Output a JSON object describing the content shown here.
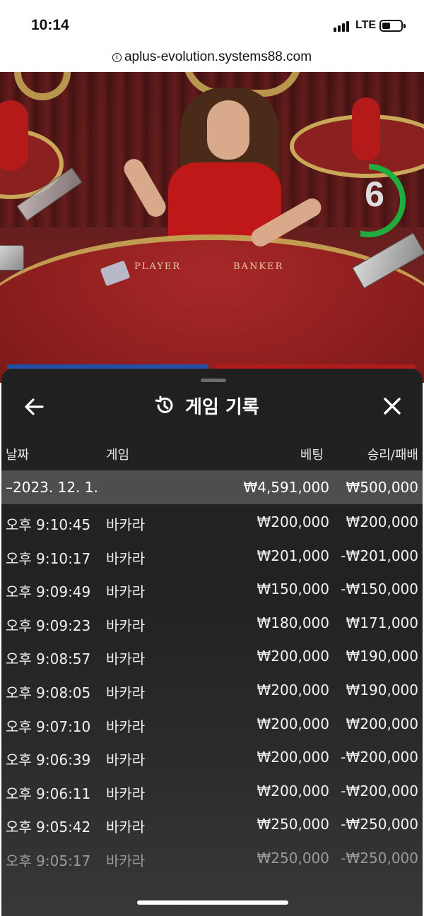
{
  "status_bar": {
    "time": "10:14",
    "network": "LTE"
  },
  "browser": {
    "url": "aplus-evolution.systems88.com"
  },
  "video": {
    "countdown": "6",
    "countdown_progress": 0.6,
    "table_labels": [
      "PLAYER",
      "BANKER"
    ]
  },
  "history": {
    "title": "게임 기록",
    "icons": {
      "back": "arrow-left-icon",
      "close": "close-x-icon",
      "title": "history-icon"
    },
    "columns": {
      "date": "날짜",
      "game": "게임",
      "bet": "베팅",
      "result": "승리/패배"
    },
    "group": {
      "date": "–2023. 12. 1.",
      "total_bet": "₩4,591,000",
      "total_result": "₩500,000"
    },
    "rows": [
      {
        "time": "오후 9:10:45",
        "game": "바카라",
        "bet": "₩200,000",
        "result": "₩200,000"
      },
      {
        "time": "오후 9:10:17",
        "game": "바카라",
        "bet": "₩201,000",
        "result": "-₩201,000"
      },
      {
        "time": "오후 9:09:49",
        "game": "바카라",
        "bet": "₩150,000",
        "result": "-₩150,000"
      },
      {
        "time": "오후 9:09:23",
        "game": "바카라",
        "bet": "₩180,000",
        "result": "₩171,000"
      },
      {
        "time": "오후 9:08:57",
        "game": "바카라",
        "bet": "₩200,000",
        "result": "₩190,000"
      },
      {
        "time": "오후 9:08:05",
        "game": "바카라",
        "bet": "₩200,000",
        "result": "₩190,000"
      },
      {
        "time": "오후 9:07:10",
        "game": "바카라",
        "bet": "₩200,000",
        "result": "₩200,000"
      },
      {
        "time": "오후 9:06:39",
        "game": "바카라",
        "bet": "₩200,000",
        "result": "-₩200,000"
      },
      {
        "time": "오후 9:06:11",
        "game": "바카라",
        "bet": "₩200,000",
        "result": "-₩200,000"
      },
      {
        "time": "오후 9:05:42",
        "game": "바카라",
        "bet": "₩250,000",
        "result": "-₩250,000"
      },
      {
        "time": "오후 9:05:17",
        "game": "바카라",
        "bet": "₩250,000",
        "result": "-₩250,000"
      }
    ]
  },
  "colors": {
    "panel_bg": "#222222",
    "group_row_bg": "#4e4e4e",
    "timer_green": "#1fae3e",
    "player_blue": "#1f4fa8",
    "banker_red": "#b01c1c"
  }
}
